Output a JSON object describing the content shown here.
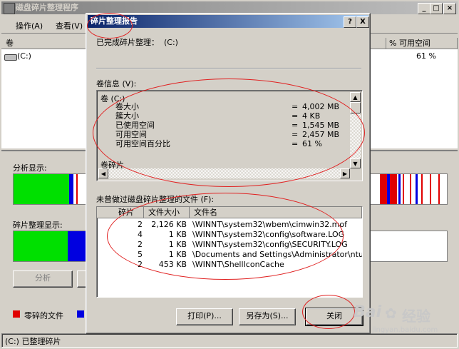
{
  "main_window": {
    "title": "磁盘碎片整理程序",
    "menu": [
      "操作(A)",
      "查看(V)"
    ],
    "col_volume": "卷",
    "col_free_pct": "% 可用空间",
    "volume_name": "(C:)",
    "volume_free_pct": "61 %",
    "analysis_label": "分析显示:",
    "defrag_label": "碎片整理显示:",
    "analyze_button": "分析",
    "legend_fragmented": "零碎的文件",
    "status_text": "(C:) 已整理碎片"
  },
  "dialog": {
    "title": "碎片整理报告",
    "help_btn": "?",
    "close_btn": "X",
    "complete_msg": "已完成碎片整理：  (C:)",
    "volume_info_label": "卷信息 (V):",
    "volume_header": "卷 (C:)",
    "volume_info": [
      {
        "label": "卷大小",
        "value": "4,002 MB"
      },
      {
        "label": "簇大小",
        "value": "4 KB"
      },
      {
        "label": "已使用空间",
        "value": "1,545 MB"
      },
      {
        "label": "可用空间",
        "value": "2,457 MB"
      },
      {
        "label": "可用空间百分比",
        "value": "61 %"
      }
    ],
    "equals": "=",
    "fragment_section": "卷碎片",
    "files_label": "未曾做过磁盘碎片整理的文件 (F):",
    "file_columns": [
      "碎片",
      "文件大小",
      "文件名"
    ],
    "files": [
      {
        "frags": "2",
        "size": "2,126 KB",
        "name": "\\WINNT\\system32\\wbem\\cimwin32.mof"
      },
      {
        "frags": "4",
        "size": "1 KB",
        "name": "\\WINNT\\system32\\config\\software.LOG"
      },
      {
        "frags": "2",
        "size": "1 KB",
        "name": "\\WINNT\\system32\\config\\SECURITY.LOG"
      },
      {
        "frags": "5",
        "size": "1 KB",
        "name": "\\Documents and Settings\\Administrator\\ntus..."
      },
      {
        "frags": "2",
        "size": "453 KB",
        "name": "\\WINNT\\ShellIconCache"
      }
    ],
    "print_button": "打印(P)...",
    "saveas_button": "另存为(S)...",
    "close_button": "关闭"
  },
  "watermark": {
    "brand": "Bai",
    "brand_tail": "经验",
    "url": "jingyan.baidu.com"
  },
  "colors": {
    "fragmented": "#e00000",
    "contiguous": "#0000e0",
    "free": "#ffffff",
    "system": "#00e000"
  }
}
